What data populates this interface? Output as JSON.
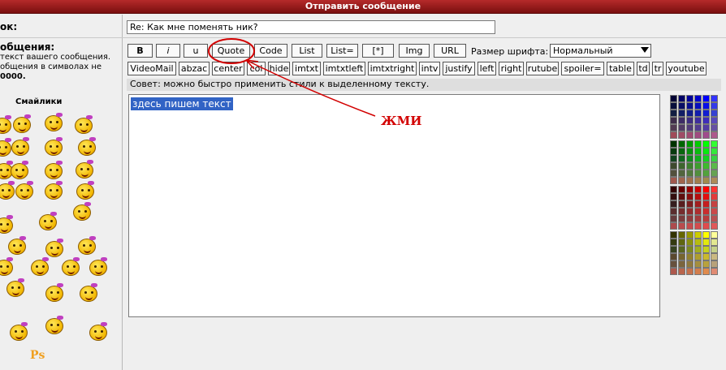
{
  "header": {
    "title": "Отправить сообщение"
  },
  "form": {
    "subject_label": "ок:",
    "subject_value": "Re: Как мне поменять ник?",
    "message_label": "общения:",
    "desc_line1": "текст вашего сообщения.",
    "desc_line2": "общения в символах не",
    "desc_line3": "0000."
  },
  "smilies": {
    "title": "Смайлики",
    "ps": "Ps"
  },
  "toolbar": {
    "row1": [
      "B",
      "i",
      "u",
      "Quote",
      "Code",
      "List",
      "List=",
      "[*]",
      "Img",
      "URL"
    ],
    "row2": [
      "VideoMail",
      "abzac",
      "center",
      "col",
      "hide",
      "imtxt",
      "imtxtleft",
      "imtxtright",
      "intv",
      "justify",
      "left",
      "right",
      "rutube",
      "spoiler=",
      "table",
      "td",
      "tr",
      "youtube"
    ],
    "font_size_label": "Размер шрифта:",
    "font_size_value": "Нормальный"
  },
  "tip": "Совет: можно быстро применить стили к выделенному тексту.",
  "message": {
    "text": "здесь пишем текст"
  },
  "annotation": {
    "text": "ЖМИ",
    "color": "#d20000"
  },
  "colors": {
    "accent": "#8b1414",
    "selection": "#3163c5"
  }
}
